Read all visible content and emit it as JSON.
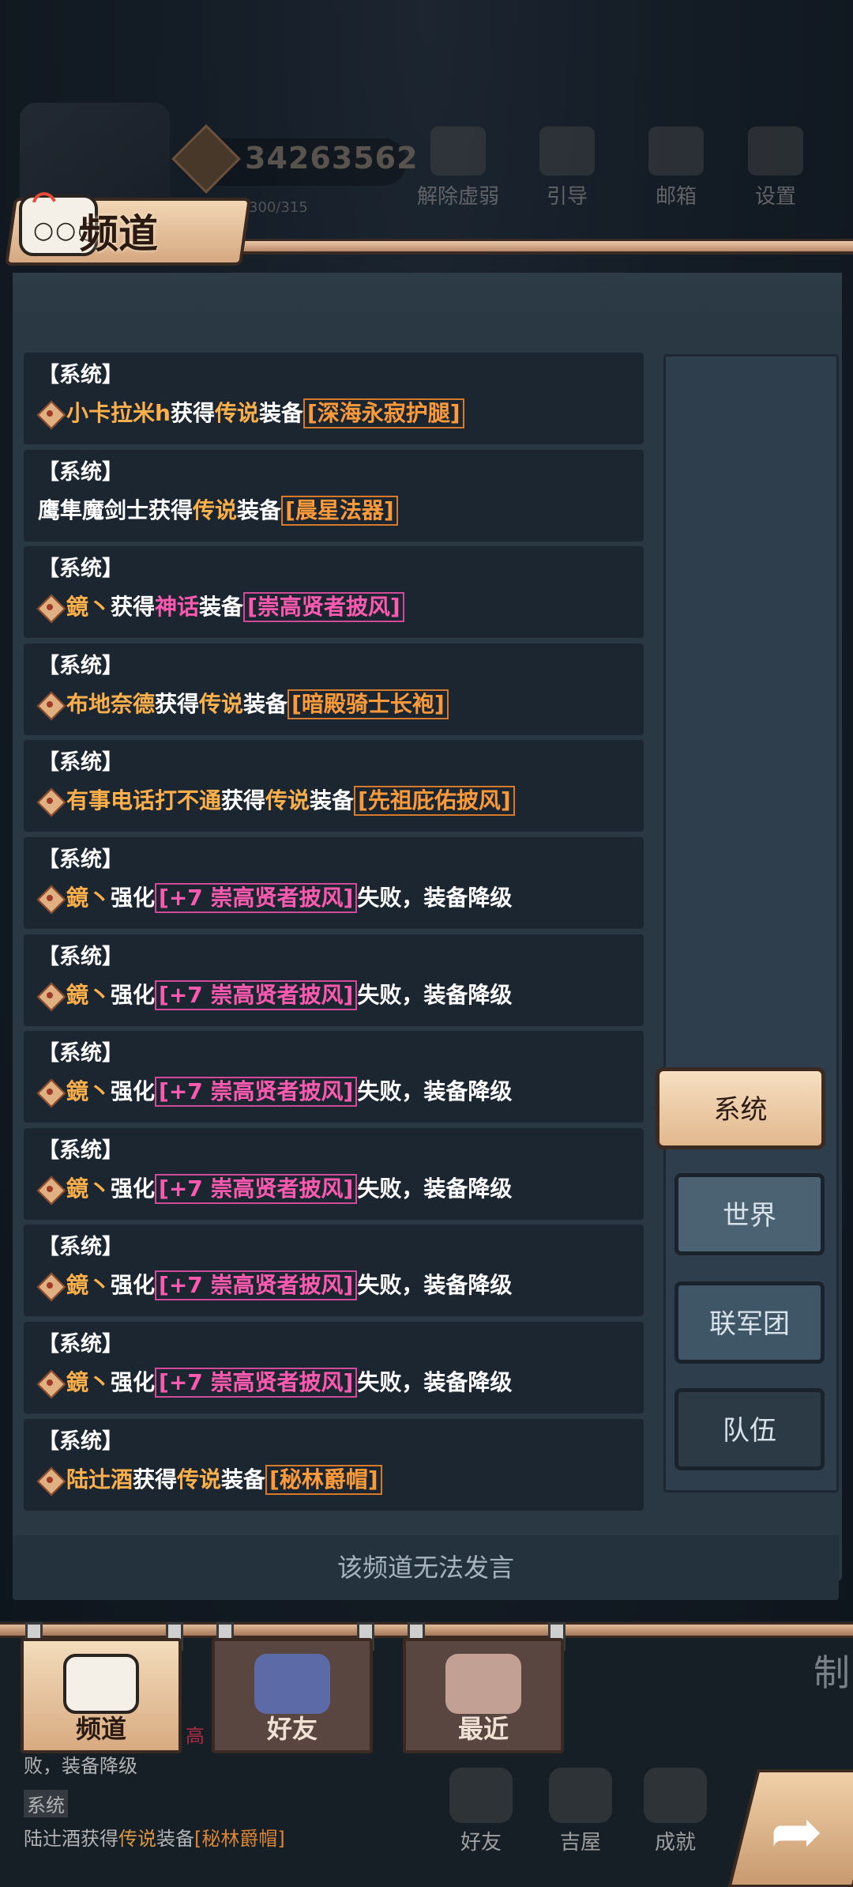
{
  "topbar": {
    "power_value": "34263562",
    "stamina": "300/315",
    "buttons": [
      {
        "label": "解除虚弱",
        "icon": "heal-icon"
      },
      {
        "label": "引导",
        "icon": "book-icon"
      },
      {
        "label": "邮箱",
        "icon": "mail-icon"
      },
      {
        "label": "设置",
        "icon": "gear-icon"
      }
    ]
  },
  "channel": {
    "title": "频道",
    "bubble_dots": "○○○"
  },
  "messages": [
    {
      "sys": "【系统】",
      "player": "小卡拉米h",
      "pre": "获得",
      "grade": "传说",
      "mid": "装备",
      "item": "[深海永寂护腿]",
      "grade_color": "orange",
      "icon": true
    },
    {
      "sys": "【系统】",
      "player": "鹰隼魔剑士",
      "pre": "获得",
      "grade": "传说",
      "mid": "装备",
      "item": "[晨星法器]",
      "grade_color": "orange",
      "icon": false,
      "player_plain": true
    },
    {
      "sys": "【系统】",
      "player": "鏡丶",
      "pre": "获得",
      "grade": "神话",
      "mid": "装备",
      "item": "[崇高贤者披风]",
      "grade_color": "pink",
      "icon": true
    },
    {
      "sys": "【系统】",
      "player": "布地奈德",
      "pre": "获得",
      "grade": "传说",
      "mid": "装备",
      "item": "[暗殿骑士长袍]",
      "grade_color": "orange",
      "icon": true
    },
    {
      "sys": "【系统】",
      "player": "有事电话打不通",
      "pre": "获得",
      "grade": "传说",
      "mid": "装备",
      "item": "[先祖庇佑披风]",
      "grade_color": "orange",
      "icon": true
    }
  ],
  "enhance_messages": [
    {
      "sys": "【系统】",
      "player": "鏡丶",
      "pre": "强化",
      "item": "[+7 崇高贤者披风]",
      "post": "失败，装备降级"
    },
    {
      "sys": "【系统】",
      "player": "鏡丶",
      "pre": "强化",
      "item": "[+7 崇高贤者披风]",
      "post": "失败，装备降级"
    },
    {
      "sys": "【系统】",
      "player": "鏡丶",
      "pre": "强化",
      "item": "[+7 崇高贤者披风]",
      "post": "失败，装备降级"
    },
    {
      "sys": "【系统】",
      "player": "鏡丶",
      "pre": "强化",
      "item": "[+7 崇高贤者披风]",
      "post": "失败，装备降级"
    },
    {
      "sys": "【系统】",
      "player": "鏡丶",
      "pre": "强化",
      "item": "[+7 崇高贤者披风]",
      "post": "失败，装备降级"
    },
    {
      "sys": "【系统】",
      "player": "鏡丶",
      "pre": "强化",
      "item": "[+7 崇高贤者披风]",
      "post": "失败，装备降级"
    }
  ],
  "last_message": {
    "sys": "【系统】",
    "player": "陆辻酒",
    "pre": "获得",
    "grade": "传说",
    "mid": "装备",
    "item": "[秘林爵帽]"
  },
  "side_tabs": {
    "system": "系统",
    "world": "世界",
    "legion": "联军团",
    "team": "队伍"
  },
  "input_placeholder": "该频道无法发言",
  "bottom_tabs": {
    "channel": "频道",
    "friends": "好友",
    "recent": "最近"
  },
  "background": {
    "partial_text_1": "败，装备降级",
    "partial_text_2": "系统",
    "partial_text_3_player": "陆辻酒",
    "partial_text_3_pre": "获得",
    "partial_text_3_grade": "传说",
    "partial_text_3_mid": "装备",
    "partial_text_3_item": "[秘林爵帽]",
    "partial_high": "高",
    "side_char": "制",
    "nav": [
      "好友",
      "吉屋",
      "成就"
    ]
  },
  "colors": {
    "legend_orange": "#ffb04a",
    "myth_pink": "#ff5ab0",
    "panel_bg": "#2a3844",
    "message_bg": "#1b2631"
  }
}
